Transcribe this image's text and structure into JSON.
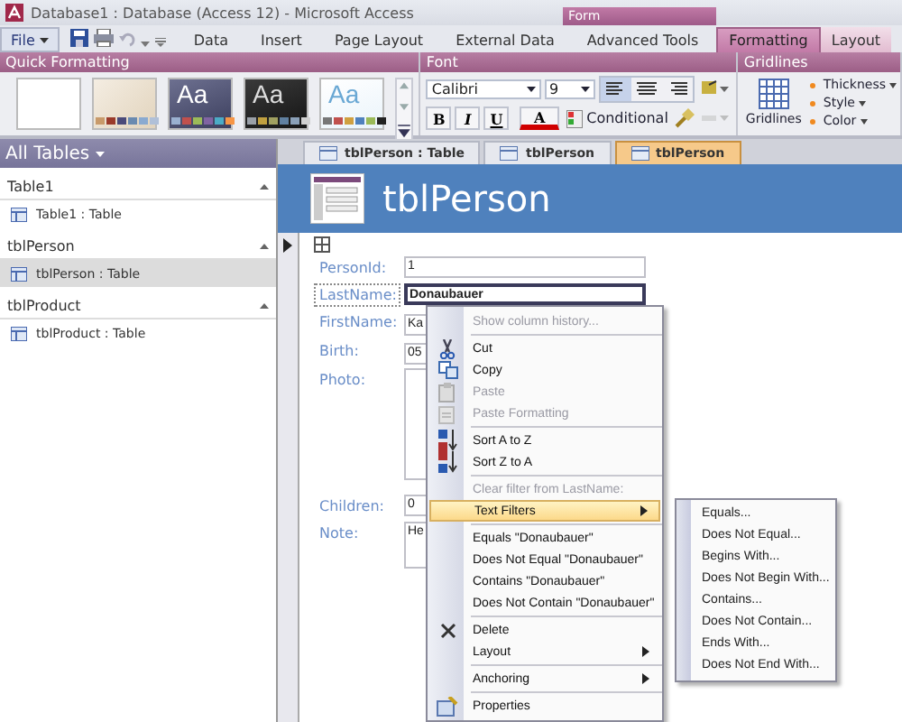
{
  "window": {
    "title": "Database1 : Database (Access 12) - Microsoft Access"
  },
  "contextual_group": {
    "label": "Form"
  },
  "file_button": {
    "label": "File"
  },
  "ribbon_tabs": [
    {
      "label": "Data",
      "selected": false,
      "contextual": false
    },
    {
      "label": "Insert",
      "selected": false,
      "contextual": false
    },
    {
      "label": "Page Layout",
      "selected": false,
      "contextual": false
    },
    {
      "label": "External Data",
      "selected": false,
      "contextual": false
    },
    {
      "label": "Advanced Tools",
      "selected": false,
      "contextual": false
    },
    {
      "label": "Formatting",
      "selected": true,
      "contextual": true
    },
    {
      "label": "Layout",
      "selected": false,
      "contextual": true
    }
  ],
  "quick_formatting": {
    "title": "Quick Formatting",
    "themes": [
      {
        "kind": "blank"
      },
      {
        "kind": "parchment"
      },
      {
        "kind": "slate",
        "sample": "Aa"
      },
      {
        "kind": "dark",
        "sample": "Aa"
      },
      {
        "kind": "light",
        "sample": "Aa"
      }
    ]
  },
  "font_group": {
    "title": "Font",
    "font_name": "Calibri",
    "font_size": "9",
    "bold": "B",
    "italic": "I",
    "underline": "U",
    "color_letter": "A",
    "conditional": "Conditional"
  },
  "gridlines_group": {
    "title": "Gridlines",
    "button": "Gridlines",
    "options": [
      "Thickness",
      "Style",
      "Color"
    ]
  },
  "nav_pane": {
    "title": "All Tables",
    "groups": [
      {
        "name": "Table1",
        "items": [
          {
            "label": "Table1 : Table",
            "selected": false
          }
        ]
      },
      {
        "name": "tblPerson",
        "items": [
          {
            "label": "tblPerson : Table",
            "selected": true
          }
        ]
      },
      {
        "name": "tblProduct",
        "items": [
          {
            "label": "tblProduct : Table",
            "selected": false
          }
        ]
      }
    ]
  },
  "doc_tabs": [
    {
      "label": "tblPerson : Table",
      "selected": false
    },
    {
      "label": "tblPerson",
      "selected": false
    },
    {
      "label": "tblPerson",
      "selected": true
    }
  ],
  "form": {
    "title": "tblPerson",
    "fields": [
      {
        "label": "PersonId:",
        "value": "1",
        "kind": "text",
        "selected": false
      },
      {
        "label": "LastName:",
        "value": "Donaubauer",
        "kind": "text",
        "selected": true
      },
      {
        "label": "FirstName:",
        "value": "Ka",
        "kind": "text",
        "selected": false
      },
      {
        "label": "Birth:",
        "value": "05",
        "kind": "text",
        "selected": false
      },
      {
        "label": "Photo:",
        "kind": "image",
        "selected": false
      },
      {
        "label": "Children:",
        "value": "0",
        "kind": "text",
        "selected": false
      },
      {
        "label": "Note:",
        "value": "He",
        "kind": "memo",
        "selected": false
      }
    ]
  },
  "context_menu": {
    "sections": [
      [
        {
          "label": "Show column history...",
          "kind": "plain",
          "disabled": true,
          "selected": false,
          "submenu": false
        }
      ],
      [
        {
          "label": "Cut",
          "kind": "cut",
          "disabled": false,
          "selected": false,
          "submenu": false
        },
        {
          "label": "Copy",
          "kind": "copy",
          "disabled": false,
          "selected": false,
          "submenu": false
        },
        {
          "label": "Paste",
          "kind": "paste",
          "disabled": true,
          "selected": false,
          "submenu": false
        },
        {
          "label": "Paste Formatting",
          "kind": "format",
          "disabled": true,
          "selected": false,
          "submenu": false
        }
      ],
      [
        {
          "label": "Sort A to Z",
          "kind": "sortaz",
          "disabled": false,
          "selected": false,
          "submenu": false
        },
        {
          "label": "Sort Z to A",
          "kind": "sortza",
          "disabled": false,
          "selected": false,
          "submenu": false
        }
      ],
      [
        {
          "label": "Clear filter from LastName:",
          "kind": "plain",
          "disabled": true,
          "selected": false,
          "submenu": false
        },
        {
          "label": "Text Filters",
          "kind": "plain",
          "disabled": false,
          "selected": true,
          "submenu": true
        }
      ],
      [
        {
          "label": "Equals \"Donaubauer\"",
          "kind": "plain",
          "disabled": false,
          "selected": false,
          "submenu": false
        },
        {
          "label": "Does Not Equal \"Donaubauer\"",
          "kind": "plain",
          "disabled": false,
          "selected": false,
          "submenu": false
        },
        {
          "label": "Contains \"Donaubauer\"",
          "kind": "plain",
          "disabled": false,
          "selected": false,
          "submenu": false
        },
        {
          "label": "Does Not Contain \"Donaubauer\"",
          "kind": "plain",
          "disabled": false,
          "selected": false,
          "submenu": false
        }
      ],
      [
        {
          "label": "Delete",
          "kind": "delete",
          "disabled": false,
          "selected": false,
          "submenu": false
        },
        {
          "label": "Layout",
          "kind": "plain",
          "disabled": false,
          "selected": false,
          "submenu": true
        }
      ],
      [
        {
          "label": "Anchoring",
          "kind": "plain",
          "disabled": false,
          "selected": false,
          "submenu": true
        }
      ],
      [
        {
          "label": "Properties",
          "kind": "props",
          "disabled": false,
          "selected": false,
          "submenu": false
        }
      ]
    ]
  },
  "submenu": {
    "items": [
      "Equals...",
      "Does Not Equal...",
      "Begins With...",
      "Does Not Begin With...",
      "Contains...",
      "Does Not Contain...",
      "Ends With...",
      "Does Not End With..."
    ]
  }
}
